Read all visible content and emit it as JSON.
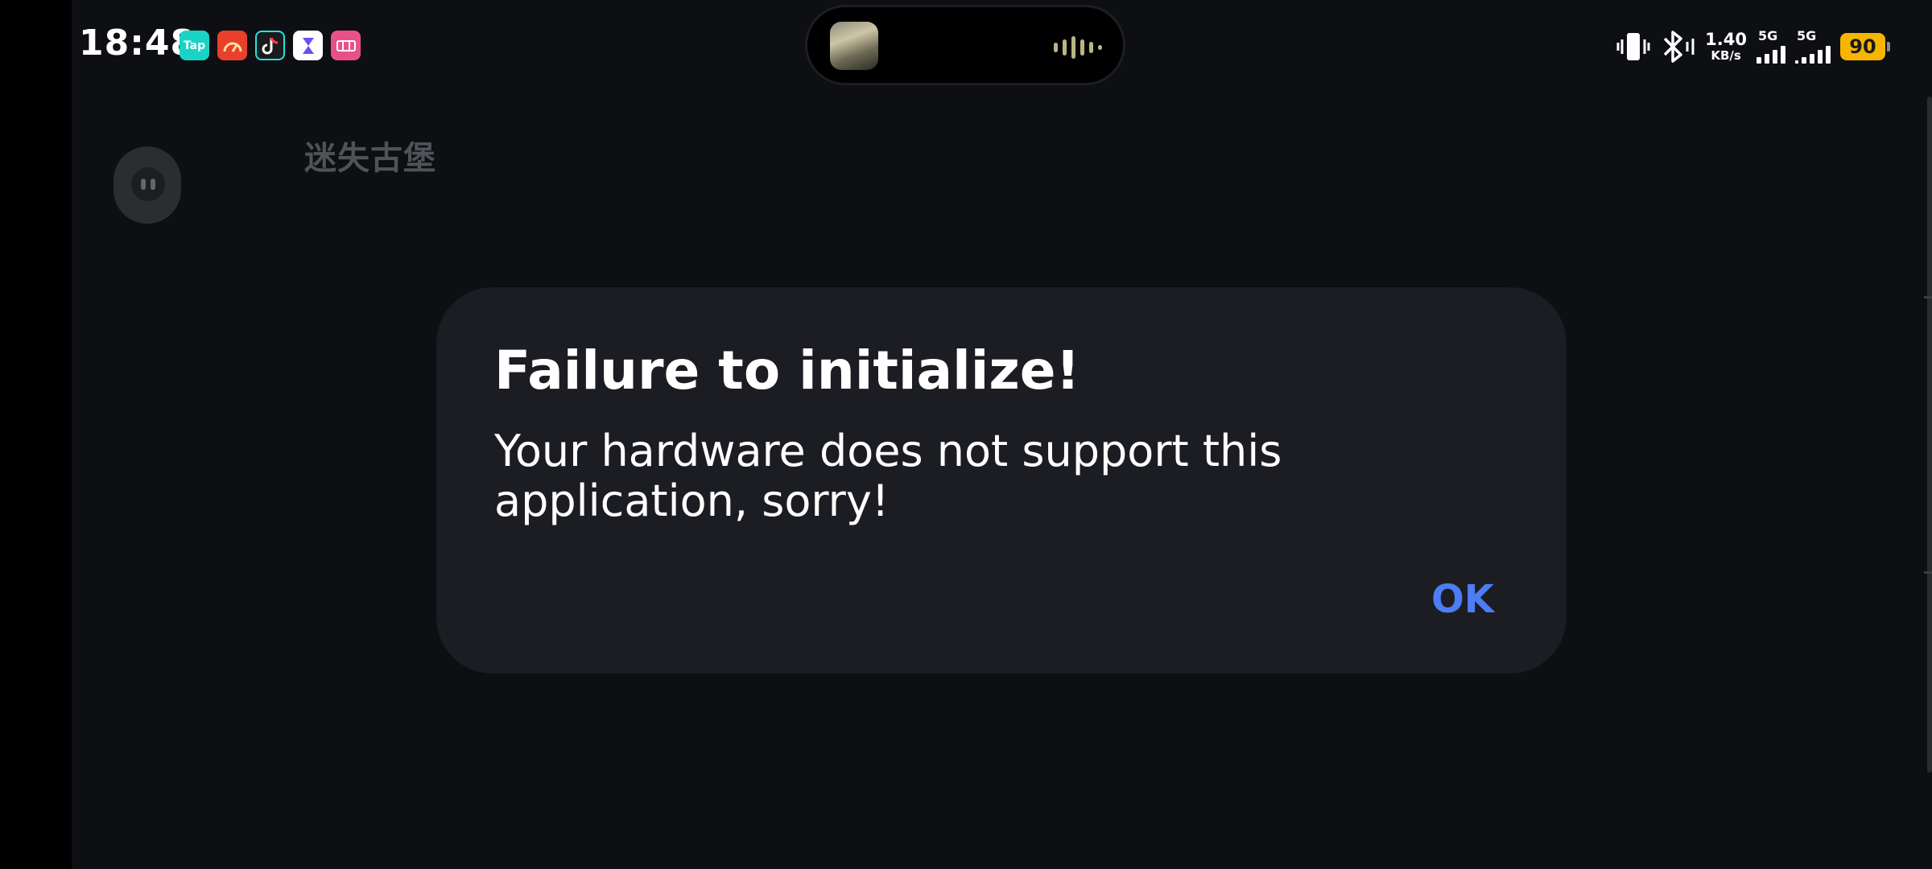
{
  "status_bar": {
    "time": "18:48",
    "notification_icons": [
      {
        "icon": "taptap-icon",
        "label": "Tap",
        "color": "#19d3c5"
      },
      {
        "icon": "speedometer-icon",
        "label": "",
        "color": "#e8402a"
      },
      {
        "icon": "tiktok-icon",
        "label": "",
        "color": "#1b1b1b"
      },
      {
        "icon": "hourglass-icon",
        "label": "",
        "color": "#ffffff"
      },
      {
        "icon": "pink-app-icon",
        "label": "",
        "color": "#e9508a"
      }
    ],
    "net_speed_value": "1.40",
    "net_speed_unit": "KB/s",
    "signal_1_label": "5G",
    "signal_2_label": "5G",
    "battery_level": "90",
    "battery_color": "#f7b500"
  },
  "background_app": {
    "title": "迷失古堡"
  },
  "dialog": {
    "title": "Failure to initialize!",
    "message": "Your hardware does not support this application, sorry!",
    "ok_label": "OK",
    "accent_color": "#4c7df5"
  }
}
